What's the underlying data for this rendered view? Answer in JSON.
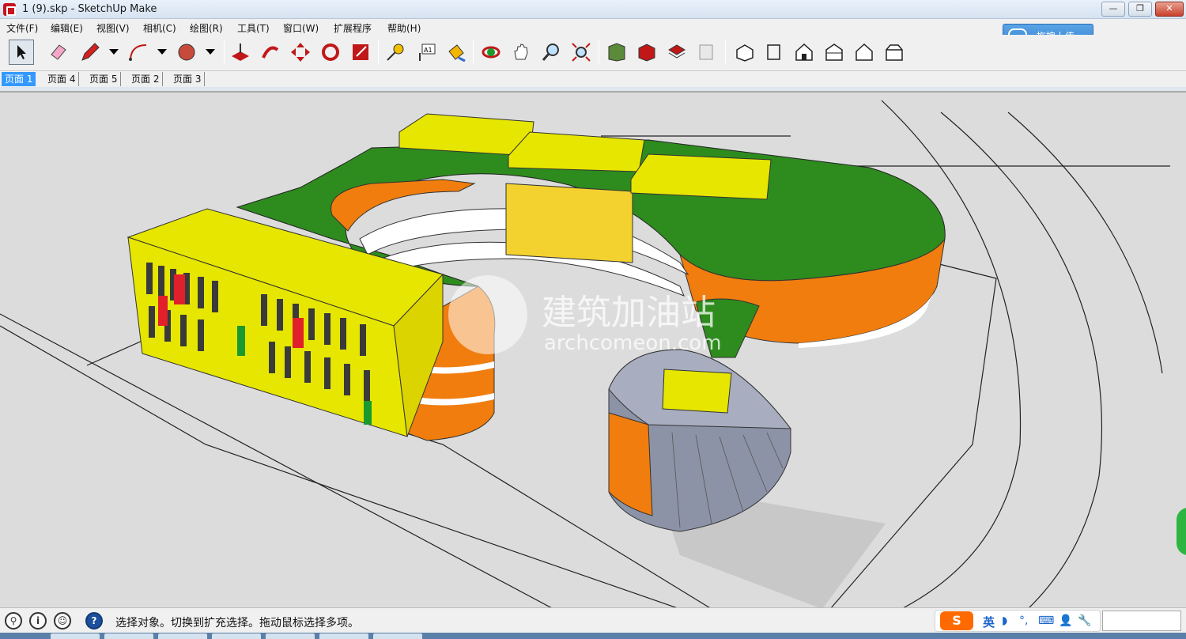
{
  "window": {
    "title": "1 (9).skp - SketchUp Make",
    "controls": {
      "minimize": "—",
      "maximize": "❐",
      "close": "✕"
    }
  },
  "menu": {
    "items": [
      "文件(F)",
      "编辑(E)",
      "视图(V)",
      "相机(C)",
      "绘图(R)",
      "工具(T)",
      "窗口(W)",
      "扩展程序",
      "帮助(H)"
    ]
  },
  "upload": {
    "label": "拖拽上传"
  },
  "toolbar": {
    "tools": [
      {
        "id": "select",
        "icon": "arrow-cursor-icon"
      },
      {
        "id": "eraser",
        "icon": "eraser-icon"
      },
      {
        "id": "pencil",
        "icon": "pencil-icon"
      },
      {
        "id": "arc",
        "icon": "arc-icon"
      },
      {
        "id": "shape",
        "icon": "circle-shape-icon"
      },
      {
        "id": "push-pull",
        "icon": "push-pull-icon"
      },
      {
        "id": "follow-me",
        "icon": "follow-me-icon"
      },
      {
        "id": "move",
        "icon": "move-icon"
      },
      {
        "id": "rotate",
        "icon": "rotate-icon"
      },
      {
        "id": "scale",
        "icon": "scale-icon"
      },
      {
        "id": "tape",
        "icon": "tape-measure-icon"
      },
      {
        "id": "text",
        "icon": "text-label-icon",
        "label": "A1"
      },
      {
        "id": "paint",
        "icon": "paint-bucket-icon"
      },
      {
        "id": "orbit",
        "icon": "orbit-icon"
      },
      {
        "id": "pan",
        "icon": "pan-hand-icon"
      },
      {
        "id": "zoom",
        "icon": "zoom-icon"
      },
      {
        "id": "zoom-extents",
        "icon": "zoom-extents-icon"
      },
      {
        "id": "warehouse",
        "icon": "model-warehouse-icon"
      },
      {
        "id": "share",
        "icon": "share-model-icon"
      },
      {
        "id": "extension",
        "icon": "extension-warehouse-icon"
      },
      {
        "id": "layout",
        "icon": "send-to-layout-icon"
      },
      {
        "id": "iso",
        "icon": "iso-view-icon"
      },
      {
        "id": "top",
        "icon": "top-view-icon"
      },
      {
        "id": "front",
        "icon": "front-view-icon"
      },
      {
        "id": "right",
        "icon": "right-view-icon"
      },
      {
        "id": "back",
        "icon": "back-view-icon"
      },
      {
        "id": "left",
        "icon": "left-view-icon"
      }
    ]
  },
  "scenes": {
    "tabs": [
      "页面 1",
      "页面 4",
      "页面 5",
      "页面 2",
      "页面 3"
    ],
    "active": "页面 1"
  },
  "viewport": {
    "watermark_title": "建筑加油站",
    "watermark_url": "archcomeon.com",
    "colors": {
      "background": "#dcdcdc",
      "roof": "#2e8b1e",
      "facade": "#f07d0e",
      "block": "#e6e600",
      "cylinder": "#8c93a6"
    }
  },
  "status": {
    "message": "选择对象。切换到扩充选择。拖动鼠标选择多项。",
    "ime": {
      "logo": "S",
      "lang": "英",
      "g1": "◗",
      "g2": "°,",
      "g3": "⌨",
      "g4": "👤",
      "g5": "🔧"
    }
  }
}
